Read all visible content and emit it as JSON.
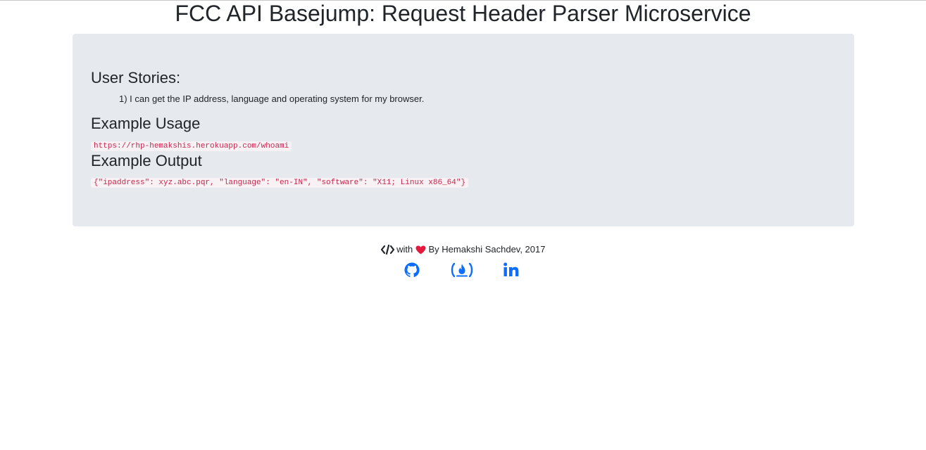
{
  "page": {
    "title": "FCC API Basejump: Request Header Parser Microservice"
  },
  "jumbotron": {
    "user_stories_heading": "User Stories:",
    "stories": [
      "1) I can get the IP address, language and operating system for my browser."
    ],
    "example_usage_heading": "Example Usage",
    "example_usage_url": "https://rhp-hemakshis.herokuapp.com/whoami",
    "example_output_heading": "Example Output",
    "example_output_json": "{\"ipaddress\": xyz.abc.pqr, \"language\": \"en-IN\", \"software\": \"X11; Linux x86_64\"}"
  },
  "footer": {
    "with_text": "with",
    "by_text": "By Hemakshi Sachdev, 2017",
    "icons": {
      "code": "code-icon",
      "heart": "heart-icon",
      "github": "github-icon",
      "freecodecamp": "freecodecamp-icon",
      "linkedin": "linkedin-icon"
    },
    "colors": {
      "heart": "#e3193e",
      "social": "#0d6efd"
    }
  }
}
